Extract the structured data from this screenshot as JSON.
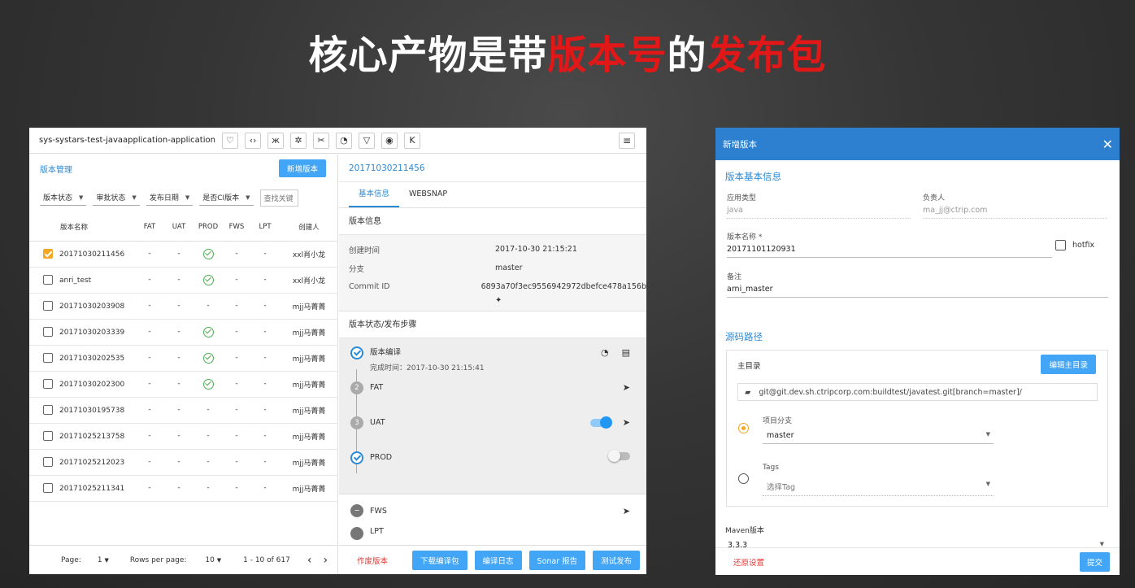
{
  "slide": {
    "title_part1": "核心产物是带",
    "title_part2": "版本号",
    "title_part3": "的",
    "title_part4": "发布包"
  },
  "app": {
    "app_name": "sys-systars-test-javaapplication-application",
    "menu_icon": "hamburger-icon",
    "toolbar_icons": [
      "heart-icon",
      "code-icon",
      "butterfly-icon",
      "bug-icon",
      "scissors-icon",
      "beacon-icon",
      "fox-icon",
      "eye-icon",
      "k-icon"
    ]
  },
  "versions": {
    "title": "版本管理",
    "new_button": "新增版本",
    "filters": [
      "版本状态",
      "审批状态",
      "发布日期",
      "是否CI版本"
    ],
    "search_placeholder": "查找关键",
    "columns": [
      "版本名称",
      "FAT",
      "UAT",
      "PROD",
      "FWS",
      "LPT",
      "创建人"
    ],
    "rows": [
      {
        "name": "20171030211456",
        "checked": true,
        "fat": "-",
        "uat": "-",
        "prod": "ok",
        "fws": "-",
        "lpt": "-",
        "creator": "xxl肖小龙"
      },
      {
        "name": "anri_test",
        "checked": false,
        "fat": "-",
        "uat": "-",
        "prod": "ok",
        "fws": "-",
        "lpt": "-",
        "creator": "xxl肖小龙"
      },
      {
        "name": "20171030203908",
        "checked": false,
        "fat": "-",
        "uat": "-",
        "prod": "-",
        "fws": "-",
        "lpt": "-",
        "creator": "mjj马菁菁"
      },
      {
        "name": "20171030203339",
        "checked": false,
        "fat": "-",
        "uat": "-",
        "prod": "ok",
        "fws": "-",
        "lpt": "-",
        "creator": "mjj马菁菁"
      },
      {
        "name": "20171030202535",
        "checked": false,
        "fat": "-",
        "uat": "-",
        "prod": "ok",
        "fws": "-",
        "lpt": "-",
        "creator": "mjj马菁菁"
      },
      {
        "name": "20171030202300",
        "checked": false,
        "fat": "-",
        "uat": "-",
        "prod": "ok",
        "fws": "-",
        "lpt": "-",
        "creator": "mjj马菁菁"
      },
      {
        "name": "20171030195738",
        "checked": false,
        "fat": "-",
        "uat": "-",
        "prod": "-",
        "fws": "-",
        "lpt": "-",
        "creator": "mjj马菁菁"
      },
      {
        "name": "20171025213758",
        "checked": false,
        "fat": "-",
        "uat": "-",
        "prod": "-",
        "fws": "-",
        "lpt": "-",
        "creator": "mjj马菁菁"
      },
      {
        "name": "20171025212023",
        "checked": false,
        "fat": "-",
        "uat": "-",
        "prod": "-",
        "fws": "-",
        "lpt": "-",
        "creator": "mjj马菁菁"
      },
      {
        "name": "20171025211341",
        "checked": false,
        "fat": "-",
        "uat": "-",
        "prod": "-",
        "fws": "-",
        "lpt": "-",
        "creator": "mjj马菁菁"
      }
    ],
    "pager": {
      "page_label": "Page:",
      "page_value": "1",
      "rows_label": "Rows per page:",
      "rows_value": "10",
      "range": "1 - 10 of 617",
      "prev": "‹",
      "next": "›"
    }
  },
  "detail": {
    "version_id": "20171030211456",
    "tabs": [
      "基本信息",
      "WEBSNAP"
    ],
    "info_title": "版本信息",
    "info": [
      {
        "k": "创建时间",
        "v": "2017-10-30 21:15:21"
      },
      {
        "k": "分支",
        "v": "master"
      },
      {
        "k": "Commit ID",
        "v": "6893a70f3ec9556942972dbefce478a156b"
      }
    ],
    "steps_title": "版本状态/发布步骤",
    "steps": {
      "build_label": "版本编译",
      "build_sub": "完成时间：2017-10-30 21:15:41",
      "fat_num": "2",
      "fat_label": "FAT",
      "uat_num": "3",
      "uat_label": "UAT",
      "prod_label": "PROD",
      "fws_label": "FWS",
      "lpt_label": "LPT"
    },
    "footer": {
      "abandon": "作废版本",
      "buttons": [
        "下载编译包",
        "编译日志",
        "Sonar 报告",
        "测试发布"
      ]
    }
  },
  "dialog": {
    "title": "新增版本",
    "basic_section": "版本基本信息",
    "app_type_label": "应用类型",
    "app_type_value": "java",
    "owner_label": "负责人",
    "owner_value": "ma_jj@ctrip.com",
    "version_name_label": "版本名称 *",
    "version_name_value": "20171101120931",
    "hotfix_label": "hotfix",
    "remark_label": "备注",
    "remark_value": "arni_master",
    "source_section": "源码路径",
    "main_dir_label": "主目录",
    "edit_main_dir": "编辑主目录",
    "repo_url": "git@git.dev.sh.ctripcorp.com:buildtest/javatest.git[branch=master]/",
    "branch_label": "项目分支",
    "branch_value": "master",
    "tags_label": "Tags",
    "tags_placeholder": "选择Tag",
    "maven_label": "Maven版本",
    "maven_value": "3.3.3",
    "reset": "还原设置",
    "submit": "提交"
  },
  "colors": {
    "accent": "#42a5f5",
    "header_blue": "#2d7fd0",
    "title_red": "#e21818",
    "ok_green": "#4caf50",
    "checked_orange": "#f5a623",
    "danger_red": "#e53935"
  }
}
